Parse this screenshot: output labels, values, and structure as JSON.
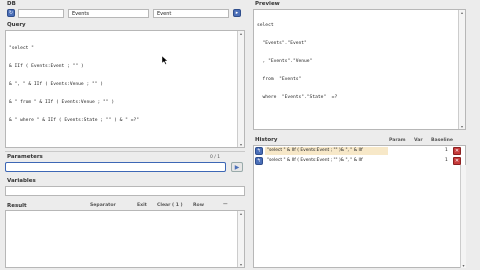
{
  "db": {
    "label": "DB",
    "table_value": "Events",
    "class_value": "Event"
  },
  "query": {
    "label": "Query",
    "lines": [
      "\"select \"",
      "& IIf ( Events:Event ; \"\" )",
      "& \", \" & IIf ( Events:Venue ; \"\" )",
      "& \" from \" & IIf ( Events:Venue ; \"\" )",
      "& \" where \" & IIf ( Events:State ; \"\" ) & \" =?\""
    ]
  },
  "parameters": {
    "label": "Parameters",
    "count": "0 / 1"
  },
  "variables": {
    "label": "Variables"
  },
  "result": {
    "label": "Result",
    "columns": [
      "Separator",
      "Exit",
      "Clear ( 1 )",
      "Row",
      "—"
    ]
  },
  "preview": {
    "label": "Preview",
    "lines": [
      "select",
      "  \"Events\".\"Event\"",
      "  , \"Events\".\"Venue\"",
      "  from  \"Events\"",
      "  where  \"Events\".\"State\"  =?"
    ]
  },
  "history": {
    "label": "History",
    "columns": [
      "Param",
      "Var",
      "Baseline"
    ],
    "rows": [
      {
        "text": "\"select \" & IIf ( Events:Event ; \"\" )& \", \" & IIf",
        "count": "1",
        "highlight": true
      },
      {
        "text": "\"select \" & IIf ( Events:Event ; \"\" )& \", \" & IIf",
        "count": "1",
        "highlight": false
      }
    ]
  },
  "colors": {
    "accent_blue": "#4b6fb8",
    "delete_red": "#c63a3a",
    "history_highlight": "#f7e8c8"
  },
  "icons": {
    "db_refresh": "refresh-icon",
    "db_go": "go-arrow-icon",
    "run": "play-icon",
    "delete": "close-icon"
  }
}
